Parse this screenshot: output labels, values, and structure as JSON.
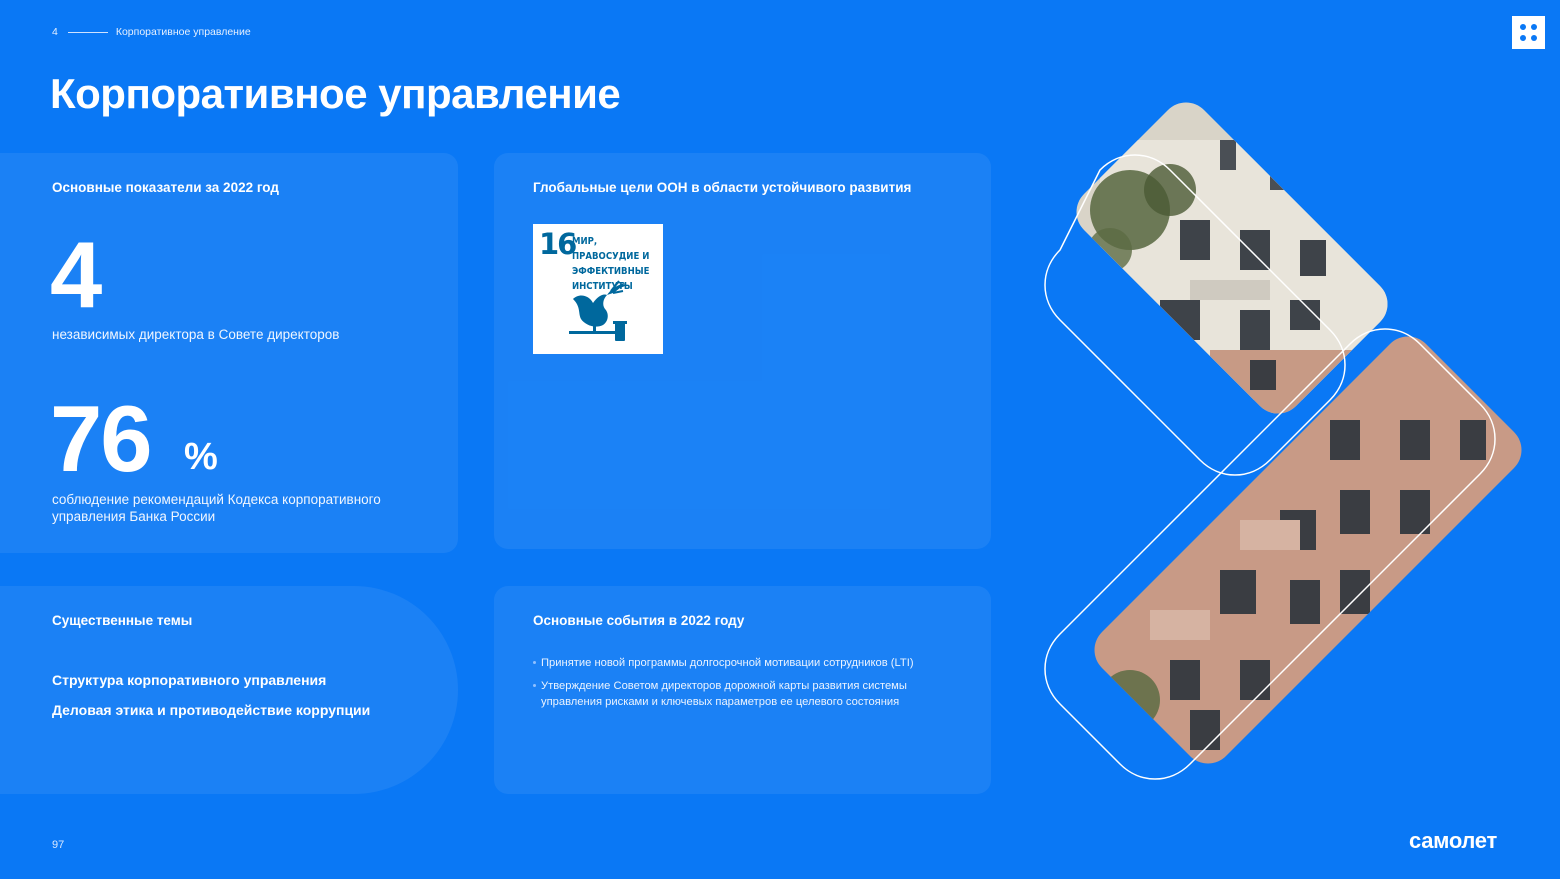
{
  "header": {
    "section_number": "4",
    "section_title": "Корпоративное управление",
    "page_title": "Корпоративное управление"
  },
  "kpi_card": {
    "heading": "Основные показатели за 2022 год",
    "metric_1_value": "4",
    "metric_1_label": "независимых директора в Совете директоров",
    "metric_2_value": "76",
    "metric_2_unit": "%",
    "metric_2_label": "соблюдение рекомендаций Кодекса корпоративного управления Банка России"
  },
  "sdg_card": {
    "heading": "Глобальные цели ООН в области устойчивого развития",
    "goal_number": "16",
    "goal_title": "МИР, ПРАВОСУДИЕ И ЭФФЕКТИВНЫЕ ИНСТИТУТЫ",
    "goal_color": "#00689d",
    "icon": "dove-gavel-icon"
  },
  "topics_card": {
    "heading": "Существенные темы",
    "items": [
      "Структура корпоративного управления",
      "Деловая этика и противодействие коррупции"
    ]
  },
  "events_card": {
    "heading": "Основные события в 2022 году",
    "items": [
      "Принятие новой программы долгосрочной мотивации сотрудников (LTI)",
      "Утверждение Советом директоров дорожной карты развития системы управления рисками и ключевых параметров ее целевого состояния"
    ]
  },
  "footer": {
    "page_number": "97",
    "logo_text": "самолет"
  },
  "colors": {
    "background": "#0a78f5",
    "card": "#2b8bf7",
    "text": "#ffffff"
  }
}
